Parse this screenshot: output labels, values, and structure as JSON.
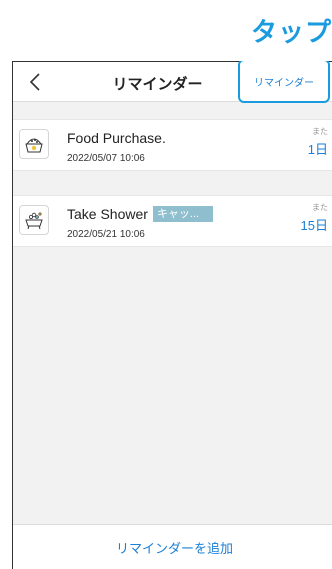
{
  "annotation": {
    "text": "タップ"
  },
  "nav": {
    "title": "リマインダー",
    "right_button_label": "リマインダー",
    "back_icon": "chevron-left-icon"
  },
  "reminders": [
    {
      "icon": "pet-food-bowl-icon",
      "title": "Food Purchase.",
      "tag": "",
      "date": "2022/05/07 10:06",
      "remaining_prefix": "また",
      "remaining": "1日"
    },
    {
      "icon": "bathtub-icon",
      "title": "Take Shower",
      "tag": "キャッ...",
      "date": "2022/05/21 10:06",
      "remaining_prefix": "また",
      "remaining": "15日"
    }
  ],
  "footer": {
    "add_label": "リマインダーを追加"
  },
  "colors": {
    "accent": "#1a7fd6",
    "highlight": "#1a9be0",
    "tag": "#8fbfcf"
  }
}
